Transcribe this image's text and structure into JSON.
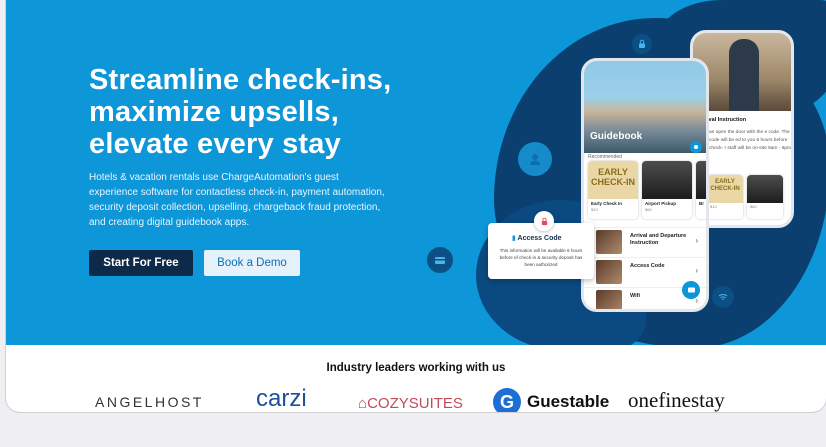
{
  "hero": {
    "headline": [
      "Streamline check-ins,",
      "maximize upsells,",
      "elevate every stay"
    ],
    "description": "Hotels & vacation rentals use ChargeAutomation's guest experience software for contactless check-in, payment automation, security deposit collection, upselling, chargeback fraud protection, and creating digital guidebook apps.",
    "primary_button": "Start For Free",
    "secondary_button": "Book a Demo"
  },
  "mockup": {
    "guidebook_label": "Guidebook",
    "recommended_label": "Recommended",
    "cards": [
      {
        "art": "EARLY CHECK-IN",
        "title": "Early Check In",
        "price": "$10"
      },
      {
        "title": "Airport Pickup",
        "price": "$60"
      },
      {
        "title": "Br",
        "price": ""
      }
    ],
    "list_items": [
      "Arrival and Departure Instruction",
      "Access Code",
      "Wifi"
    ],
    "access_card": {
      "title": "Access Code",
      "body": "This information will be available 6 hours before of check-in & security deposit has been authorized"
    },
    "arrival_phone": {
      "title": "ival Instruction",
      "text": "an open the door with the e code. The code will be ed to you 6 hours before check- r staff will be on-site 8am - 6pm",
      "mini_card_art": "EARLY CHECK-IN",
      "mini_prices": [
        "$10",
        "$60"
      ]
    }
  },
  "partners": {
    "title": "Industry leaders working with us",
    "logos": [
      "ANGELHOST",
      "carzi",
      "COZYSUITES",
      "Guestable",
      "onefinestay"
    ]
  },
  "colors": {
    "hero_bg": "#0d96d8",
    "navy": "#0d2a4a",
    "blob": "#0a3f6f"
  }
}
